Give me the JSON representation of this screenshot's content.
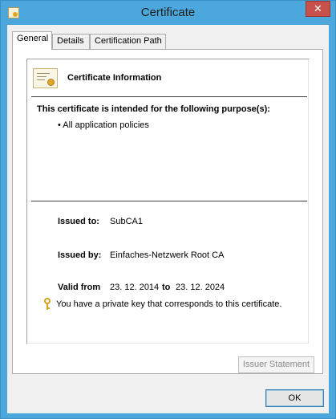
{
  "window": {
    "title": "Certificate",
    "close_label": "✕"
  },
  "tabs": [
    {
      "label": "General"
    },
    {
      "label": "Details"
    },
    {
      "label": "Certification Path"
    }
  ],
  "general": {
    "info_title": "Certificate Information",
    "purpose_heading": "This certificate is intended for the following purpose(s):",
    "purpose_items": [
      "• All application policies"
    ],
    "issued_to_label": "Issued to:",
    "issued_to_value": "SubCA1",
    "issued_by_label": "Issued by:",
    "issued_by_value": "Einfaches-Netzwerk Root CA",
    "valid_from_label": "Valid from",
    "valid_from_value": "23. 12. 2014",
    "valid_to_label": "to",
    "valid_to_value": "23. 12. 2024",
    "private_key_note": "You have a private key that corresponds to this certificate.",
    "issuer_statement_label": "Issuer Statement"
  },
  "footer": {
    "ok_label": "OK"
  }
}
